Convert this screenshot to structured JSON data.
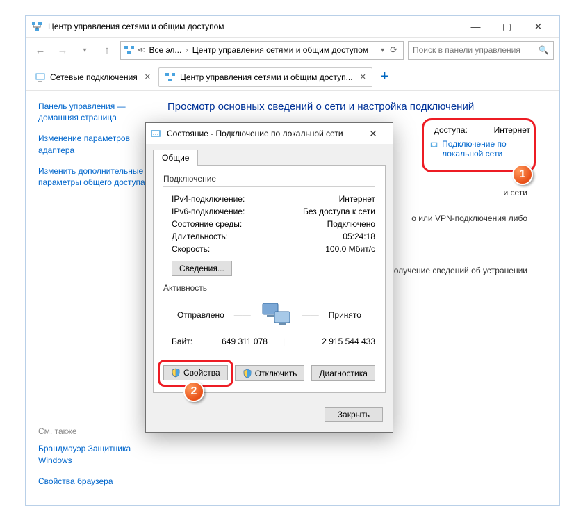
{
  "window": {
    "title": "Центр управления сетями и общим доступом",
    "breadcrumbs": [
      "Все эл...",
      "Центр управления сетями и общим доступом"
    ],
    "search_placeholder": "Поиск в панели управления"
  },
  "tabs": [
    {
      "label": "Сетевые подключения",
      "active": false
    },
    {
      "label": "Центр управления сетями и общим доступ...",
      "active": true
    }
  ],
  "sidebar": {
    "items": [
      "Панель управления — домашняя страница",
      "Изменение параметров адаптера",
      "Изменить дополнительные параметры общего доступа"
    ],
    "footer_label": "См. также",
    "footer_items": [
      "Брандмауэр Защитника Windows",
      "Свойства браузера"
    ]
  },
  "main": {
    "headline": "Просмотр основных сведений о сети и настройка подключений",
    "access_label_suffix": "доступа:",
    "access_value": "Интернет",
    "connection_label": "Подключение по локальной сети",
    "partial1": "и сети",
    "partial2": "о или VPN-подключения либо",
    "partial3": "или получение сведений об устранении"
  },
  "dialog": {
    "title": "Состояние - Подключение по локальной сети",
    "tab": "Общие",
    "group_connection": "Подключение",
    "rows": [
      {
        "k": "IPv4-подключение:",
        "v": "Интернет"
      },
      {
        "k": "IPv6-подключение:",
        "v": "Без доступа к сети"
      },
      {
        "k": "Состояние среды:",
        "v": "Подключено"
      },
      {
        "k": "Длительность:",
        "v": "05:24:18"
      },
      {
        "k": "Скорость:",
        "v": "100.0 Мбит/с"
      }
    ],
    "details_btn": "Сведения...",
    "group_activity": "Активность",
    "sent_label": "Отправлено",
    "recv_label": "Принято",
    "bytes_label": "Байт:",
    "bytes_sent": "649 311 078",
    "bytes_recv": "2 915 544 433",
    "btn_properties": "Свойства",
    "btn_disable": "Отключить",
    "btn_diagnose": "Диагностика",
    "btn_close": "Закрыть"
  },
  "badges": {
    "one": "1",
    "two": "2"
  }
}
